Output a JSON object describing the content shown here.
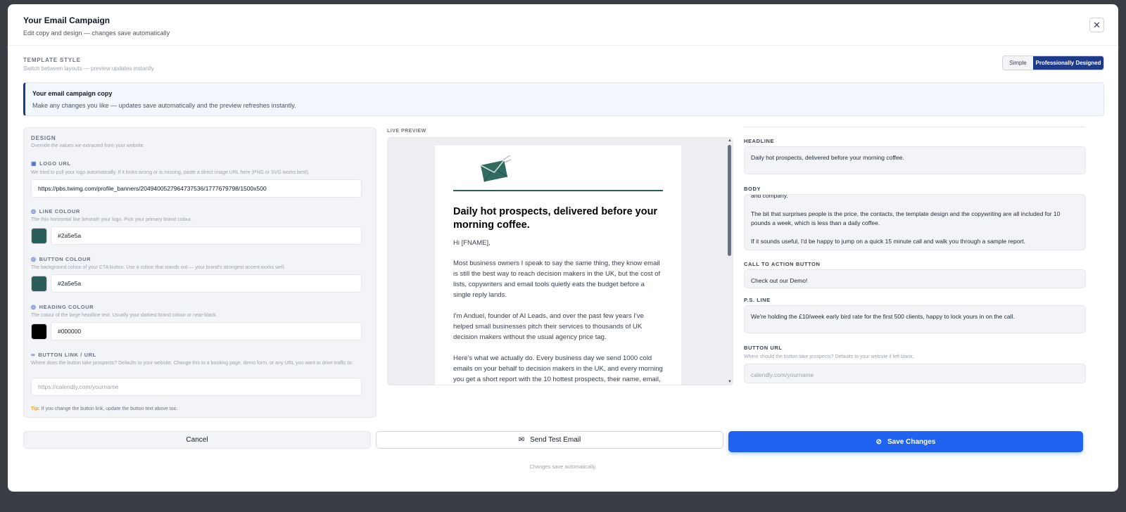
{
  "header": {
    "title": "Your Email Campaign",
    "subtitle": "Edit copy and design — changes save automatically",
    "close_icon": "close-icon"
  },
  "template_style": {
    "label": "TEMPLATE STYLE",
    "subtitle": "Switch between layouts — preview updates instantly",
    "options": [
      "Simple",
      "Professionally Designed"
    ],
    "selected": "Professionally Designed"
  },
  "info": {
    "title": "Your email campaign copy",
    "text": "Make any changes you like — updates save automatically and the preview refreshes instantly."
  },
  "design": {
    "title": "DESIGN",
    "subtitle": "Override the values we extracted from your website.",
    "logo": {
      "label": "LOGO URL",
      "help": "We tried to pull your logo automatically. If it looks wrong or is missing, paste a direct image URL here (PNG or SVG works best).",
      "value": "https://pbs.twimg.com/profile_banners/2049400527964737536/1777679798/1500x500"
    },
    "line_colour": {
      "label": "LINE COLOUR",
      "help": "The thin horizontal line beneath your logo. Pick your primary brand colour.",
      "value": "#2a5e5a"
    },
    "button_colour": {
      "label": "BUTTON COLOUR",
      "help": "The background colour of your CTA button. Use a colour that stands out — your brand's strongest accent works well.",
      "value": "#2a5e5a"
    },
    "heading_colour": {
      "label": "HEADING COLOUR",
      "help": "The colour of the large headline text. Usually your darkest brand colour or near-black.",
      "value": "#000000"
    },
    "button_link": {
      "label": "BUTTON LINK / URL",
      "help": "Where does the button take prospects? Defaults to your website. Change this to a booking page, demo form, or any URL you want to drive traffic to.",
      "placeholder": "https://calendly.com/yourname"
    },
    "tip_label": "Tip:",
    "tip_text": " If you change the button link, update the button text above too."
  },
  "preview": {
    "label": "LIVE PREVIEW",
    "headline": "Daily hot prospects, delivered before your morning coffee.",
    "greeting": "Hi [FNAME],",
    "paragraphs": [
      "Most business owners I speak to say the same thing, they know email is still the best way to reach decision makers in the UK, but the cost of lists, copywriters and email tools quietly eats the budget before a single reply lands.",
      "I'm Anduel, founder of AI Leads, and over the past few years I've helped small businesses pitch their services to thousands of UK decision makers without the usual agency price tag.",
      "Here's what we actually do. Every business day we send 1000 cold emails on your behalf to decision makers in the UK, and every morning you get a short report with the 10 hottest prospects, their name, email,"
    ]
  },
  "fields": {
    "headline": {
      "label": "HEADLINE",
      "value": "Daily hot prospects, delivered before your morning coffee."
    },
    "body": {
      "label": "BODY",
      "line0": "and company.",
      "line1": "The bit that surprises people is the price, the contacts, the template design and the copywriting are all included for 10 pounds a week, which is less than a daily coffee.",
      "line2": "If it sounds useful, I'd be happy to jump on a quick 15 minute call and walk you through a sample report."
    },
    "cta": {
      "label": "CALL TO ACTION BUTTON",
      "value": "Check out our Demo!"
    },
    "ps": {
      "label": "P.S. LINE",
      "value": "We're holding the £10/week early bird rate for the first 500 clients, happy to lock yours in on the call."
    },
    "button_url": {
      "label": "BUTTON URL",
      "help": "Where should the button take prospects? Defaults to your website if left blank.",
      "placeholder": "calendly.com/yourname"
    }
  },
  "actions": {
    "cancel": "Cancel",
    "test": "Send Test Email",
    "save": "Save Changes",
    "note": "Changes save automatically."
  },
  "colors": {
    "accent": "#1f63f0",
    "brand": "#2a5e5a",
    "navy": "#1e3a8a"
  }
}
